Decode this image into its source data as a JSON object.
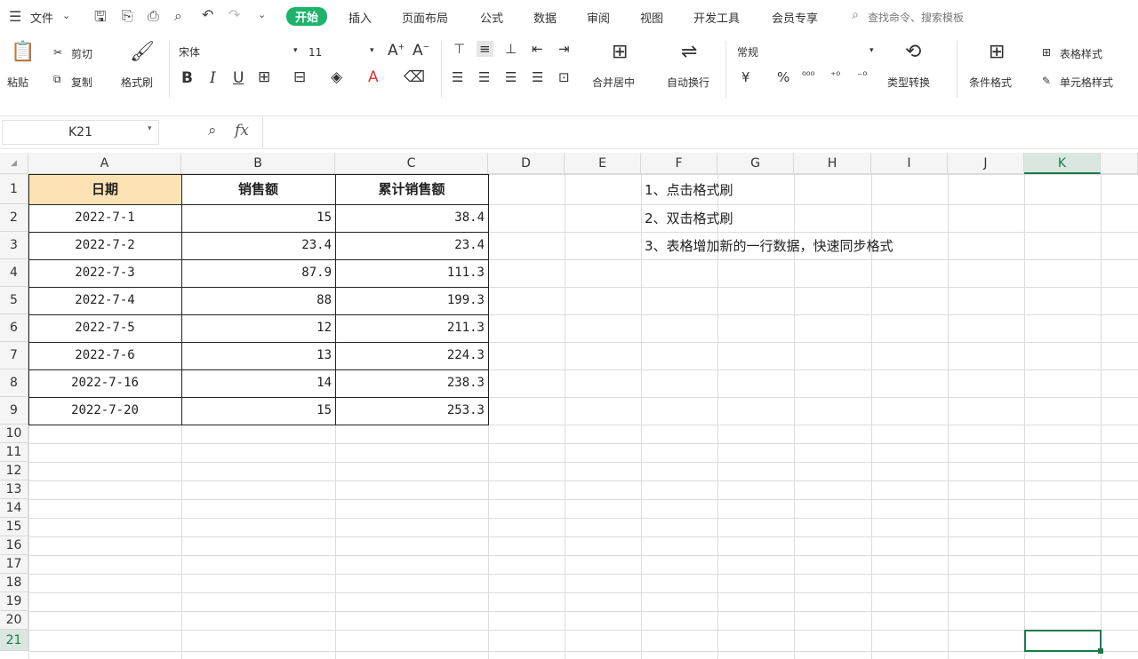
{
  "menu": {
    "file": "文件",
    "tabs": [
      "开始",
      "插入",
      "页面布局",
      "公式",
      "数据",
      "审阅",
      "视图",
      "开发工具",
      "会员专享"
    ],
    "search_placeholder": "查找命令、搜索模板"
  },
  "ribbon": {
    "paste": "粘贴",
    "cut": "剪切",
    "copy": "复制",
    "format_painter": "格式刷",
    "font_name": "宋体",
    "font_size": "11",
    "merge_center": "合并居中",
    "wrap_text": "自动换行",
    "number_format": "常规",
    "type_convert": "类型转换",
    "conditional_format": "条件格式",
    "table_style": "表格样式",
    "cell_style": "单元格样式",
    "bold": "B",
    "italic": "I",
    "underline": "U",
    "currency": "¥",
    "percent": "%"
  },
  "formula_bar": {
    "name_box": "K21",
    "fx": "fx"
  },
  "columns": [
    "A",
    "B",
    "C",
    "D",
    "E",
    "F",
    "G",
    "H",
    "I",
    "J",
    "K"
  ],
  "rows": [
    "1",
    "2",
    "3",
    "4",
    "5",
    "6",
    "7",
    "8",
    "9",
    "10",
    "11",
    "12",
    "13",
    "14",
    "15",
    "16",
    "17",
    "18",
    "19",
    "20",
    "21"
  ],
  "table": {
    "headers": [
      "日期",
      "销售额",
      "累计销售额"
    ],
    "rows": [
      [
        "2022-7-1",
        "15",
        "38.4"
      ],
      [
        "2022-7-2",
        "23.4",
        "23.4"
      ],
      [
        "2022-7-3",
        "87.9",
        "111.3"
      ],
      [
        "2022-7-4",
        "88",
        "199.3"
      ],
      [
        "2022-7-5",
        "12",
        "211.3"
      ],
      [
        "2022-7-6",
        "13",
        "224.3"
      ],
      [
        "2022-7-16",
        "14",
        "238.3"
      ],
      [
        "2022-7-20",
        "15",
        "253.3"
      ]
    ]
  },
  "notes": [
    "1、点击格式刷",
    "2、双击格式刷",
    "3、表格增加新的一行数据，快速同步格式"
  ],
  "colors": {
    "accent": "#1db36b",
    "header_fill": "#fde3b4",
    "selection": "#1a7a4c"
  }
}
